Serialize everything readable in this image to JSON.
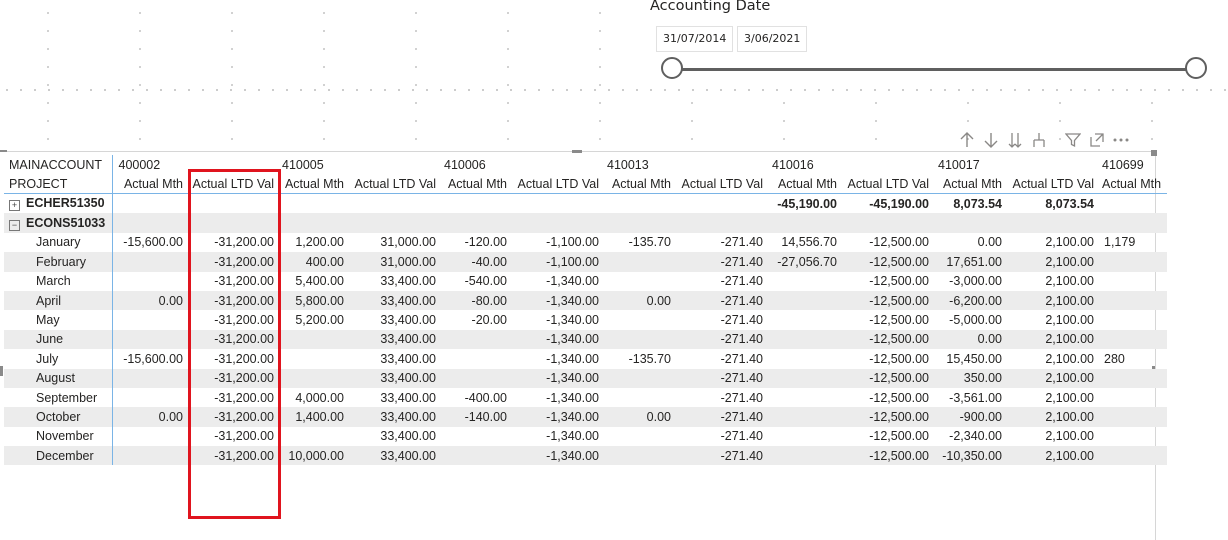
{
  "slicer": {
    "title": "Accounting Date",
    "start_date": "31/07/2014",
    "end_date": "3/06/2021"
  },
  "toolbar": {
    "icons": [
      "arrow-up-icon",
      "arrow-down-icon",
      "double-arrow-down-icon",
      "expand-hierarchy-icon",
      "filter-icon",
      "focus-mode-icon",
      "more-options-icon"
    ],
    "labels": {
      "up": "↑",
      "down": "↓",
      "double_down": "⇊",
      "fork": "⅄",
      "filter": "▽",
      "focus": "⤢",
      "more": "···"
    }
  },
  "matrix": {
    "row_header_titles": [
      "MAINACCOUNT",
      "PROJECT"
    ],
    "accounts": [
      "400002",
      "410005",
      "410006",
      "410013",
      "410016",
      "410017",
      "410699"
    ],
    "measures": [
      "Actual Mth",
      "Actual LTD Val"
    ],
    "group_1": {
      "label": "ECHER51350",
      "expander": "+",
      "values": [
        "",
        "",
        "",
        "",
        "",
        "",
        "",
        "",
        "-45,190.00",
        "-45,190.00",
        "8,073.54",
        "8,073.54",
        ""
      ]
    },
    "group_2": {
      "label": "ECONS51033",
      "expander": "−"
    },
    "rows": [
      {
        "label": "January",
        "values": [
          "-15,600.00",
          "-31,200.00",
          "1,200.00",
          "31,000.00",
          "-120.00",
          "-1,100.00",
          "-135.70",
          "-271.40",
          "14,556.70",
          "-12,500.00",
          "0.00",
          "2,100.00",
          "1,179"
        ]
      },
      {
        "label": "February",
        "values": [
          "",
          "-31,200.00",
          "400.00",
          "31,000.00",
          "-40.00",
          "-1,100.00",
          "",
          "-271.40",
          "-27,056.70",
          "-12,500.00",
          "17,651.00",
          "2,100.00",
          ""
        ]
      },
      {
        "label": "March",
        "values": [
          "",
          "-31,200.00",
          "5,400.00",
          "33,400.00",
          "-540.00",
          "-1,340.00",
          "",
          "-271.40",
          "",
          "-12,500.00",
          "-3,000.00",
          "2,100.00",
          ""
        ]
      },
      {
        "label": "April",
        "values": [
          "0.00",
          "-31,200.00",
          "5,800.00",
          "33,400.00",
          "-80.00",
          "-1,340.00",
          "0.00",
          "-271.40",
          "",
          "-12,500.00",
          "-6,200.00",
          "2,100.00",
          ""
        ]
      },
      {
        "label": "May",
        "values": [
          "",
          "-31,200.00",
          "5,200.00",
          "33,400.00",
          "-20.00",
          "-1,340.00",
          "",
          "-271.40",
          "",
          "-12,500.00",
          "-5,000.00",
          "2,100.00",
          ""
        ]
      },
      {
        "label": "June",
        "values": [
          "",
          "-31,200.00",
          "",
          "33,400.00",
          "",
          "-1,340.00",
          "",
          "-271.40",
          "",
          "-12,500.00",
          "0.00",
          "2,100.00",
          ""
        ]
      },
      {
        "label": "July",
        "values": [
          "-15,600.00",
          "-31,200.00",
          "",
          "33,400.00",
          "",
          "-1,340.00",
          "-135.70",
          "-271.40",
          "",
          "-12,500.00",
          "15,450.00",
          "2,100.00",
          "280"
        ]
      },
      {
        "label": "August",
        "values": [
          "",
          "-31,200.00",
          "",
          "33,400.00",
          "",
          "-1,340.00",
          "",
          "-271.40",
          "",
          "-12,500.00",
          "350.00",
          "2,100.00",
          ""
        ]
      },
      {
        "label": "September",
        "values": [
          "",
          "-31,200.00",
          "4,000.00",
          "33,400.00",
          "-400.00",
          "-1,340.00",
          "",
          "-271.40",
          "",
          "-12,500.00",
          "-3,561.00",
          "2,100.00",
          ""
        ]
      },
      {
        "label": "October",
        "values": [
          "0.00",
          "-31,200.00",
          "1,400.00",
          "33,400.00",
          "-140.00",
          "-1,340.00",
          "0.00",
          "-271.40",
          "",
          "-12,500.00",
          "-900.00",
          "2,100.00",
          ""
        ]
      },
      {
        "label": "November",
        "values": [
          "",
          "-31,200.00",
          "",
          "33,400.00",
          "",
          "-1,340.00",
          "",
          "-271.40",
          "",
          "-12,500.00",
          "-2,340.00",
          "2,100.00",
          ""
        ]
      },
      {
        "label": "December",
        "values": [
          "",
          "-31,200.00",
          "10,000.00",
          "33,400.00",
          "",
          "-1,340.00",
          "",
          "-271.40",
          "",
          "-12,500.00",
          "-10,350.00",
          "2,100.00",
          ""
        ]
      }
    ]
  },
  "highlight": {
    "color": "#e0141e"
  }
}
